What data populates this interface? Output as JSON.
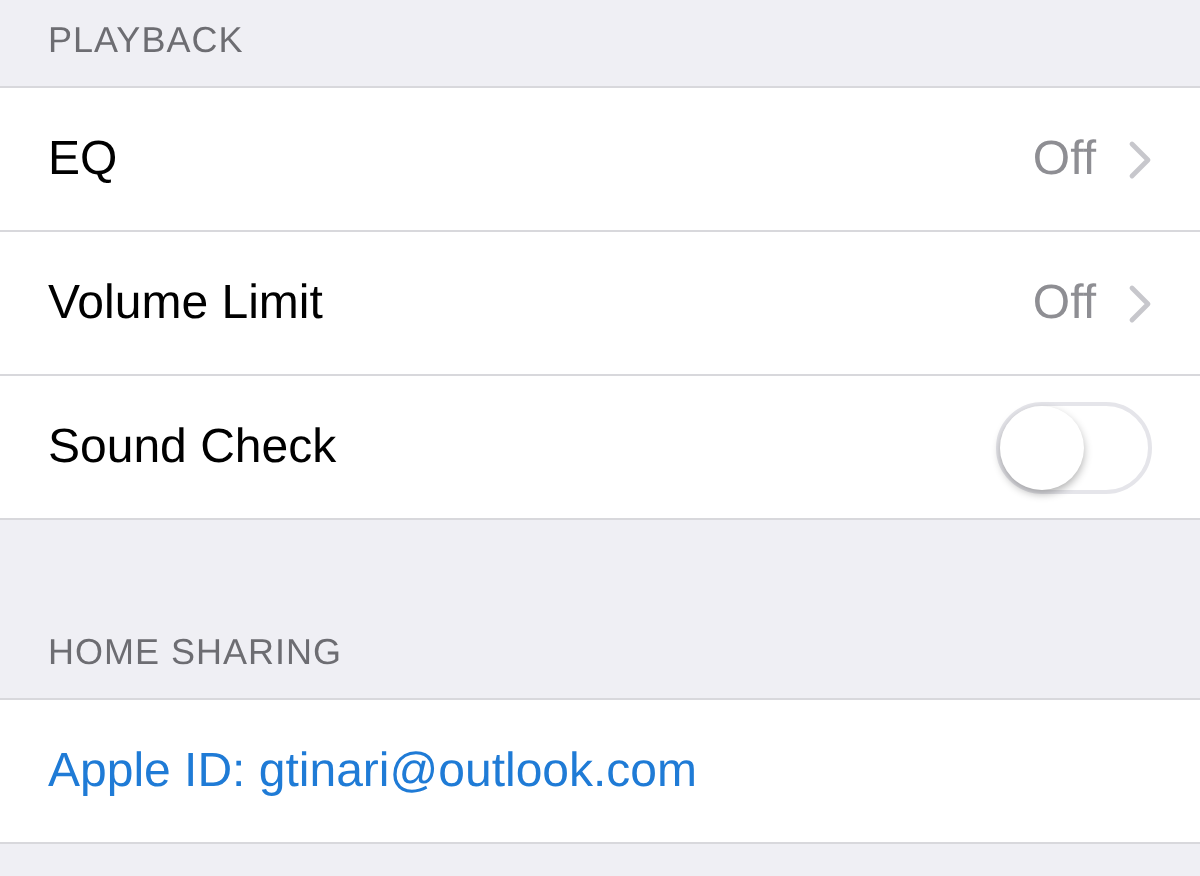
{
  "sections": [
    {
      "header": "PLAYBACK",
      "rows": [
        {
          "kind": "detail",
          "label": "EQ",
          "value": "Off"
        },
        {
          "kind": "detail",
          "label": "Volume Limit",
          "value": "Off"
        },
        {
          "kind": "toggle",
          "label": "Sound Check",
          "on": false
        }
      ]
    },
    {
      "header": "HOME SHARING",
      "rows": [
        {
          "kind": "link",
          "label": "Apple ID: gtinari@outlook.com"
        }
      ]
    }
  ]
}
